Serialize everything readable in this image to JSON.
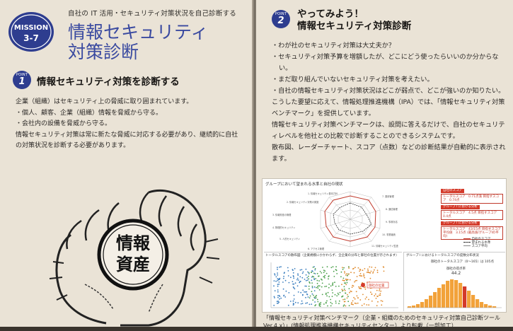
{
  "badge": {
    "word": "MISSION",
    "number": "3-7"
  },
  "left": {
    "subtitle": "自社の IT 活用・セキュリティ対策状況を自己診断する",
    "title_line1": "情報セキュリティ",
    "title_line2": "対策診断",
    "point_label": "POINT",
    "point_number": "1",
    "heading": "情報セキュリティ対策を診断する",
    "body": [
      "企業（組織）はセキュリティ上の脅威に取り囲まれています。",
      "・個人、顧客、企業（組織）情報を脅威から守る。",
      "・会社内の設備を脅威から守る。",
      "情報セキュリティ対策は常に新たな脅威に対応する必要があり、継続的に自社の対策状況を診断する必要があります。"
    ],
    "illustration_text_line1": "情報",
    "illustration_text_line2": "資産"
  },
  "right": {
    "point_label": "POINT",
    "point_number": "2",
    "heading_line1": "やってみよう！",
    "heading_line2": "情報セキュリティ対策診断",
    "bullets": [
      "・わが社のセキュリティ対策は大丈夫か？",
      "・セキュリティ対策予算を増額したが、どこにどう使ったらいいのか分からない。",
      "・まだ取り組んでいないセキュリティ対策を考えたい。",
      "・自社の情報セキュリティ対策状況はどこが弱点で、どこが強いのか知りたい。"
    ],
    "paragraphs": [
      "こうした要望に応えて、情報処理推進機構（IPA）では、「情報セキュリティ対策ベンチマーク」を提供しています。",
      "情報セキュリティ対策ベンチマークは、設問に答えるだけで、自社のセキュリティレベルを他社との比較で診断することのできるシステムです。",
      "散布図、レーダーチャート、スコア（点数）などの診断結果が自動的に表示されます。"
    ],
    "figure": {
      "radar_title": "グループにおいて望まれる水準と自社の現状",
      "legend_heading1": "自社のスコア",
      "legend_box1": "トータルスコア　0.71点満\n目指すスコア　0.74点",
      "legend_heading2": "グループ I における分析",
      "legend_box2": "トータルスコア　4.5点\n目指すスコア　0.4点",
      "legend_heading3": "グループ I における分析",
      "legend_box3": "トータルスコア　43/15点\n目指すスコア平均値　3.15点\n(最高値/グループIの平均)",
      "legend_items": [
        "自社のスコア",
        "望まれる水準",
        "スコア平均"
      ],
      "scatter_title": "トータルスコアの散布図（企業規模にかかわらず、全企業の分布と御社の位置が示されます）",
      "scatter_label": "御社の位置",
      "hist_title": "グループ I におけるトータルスコアの度数分布状況",
      "hist_subtitle": "御社のトータルスコア（0～165）は 105点",
      "hist_avg_label": "御社の得点率",
      "hist_avg_value": "44.2"
    },
    "caption": "「情報セキュリティ対策ベンチマーク（企業・組織のためのセキュリティ対策自己診断ツールVer.4.x）」(情報処理推進機構セキュリティセンター）より転載（一部加工）"
  }
}
